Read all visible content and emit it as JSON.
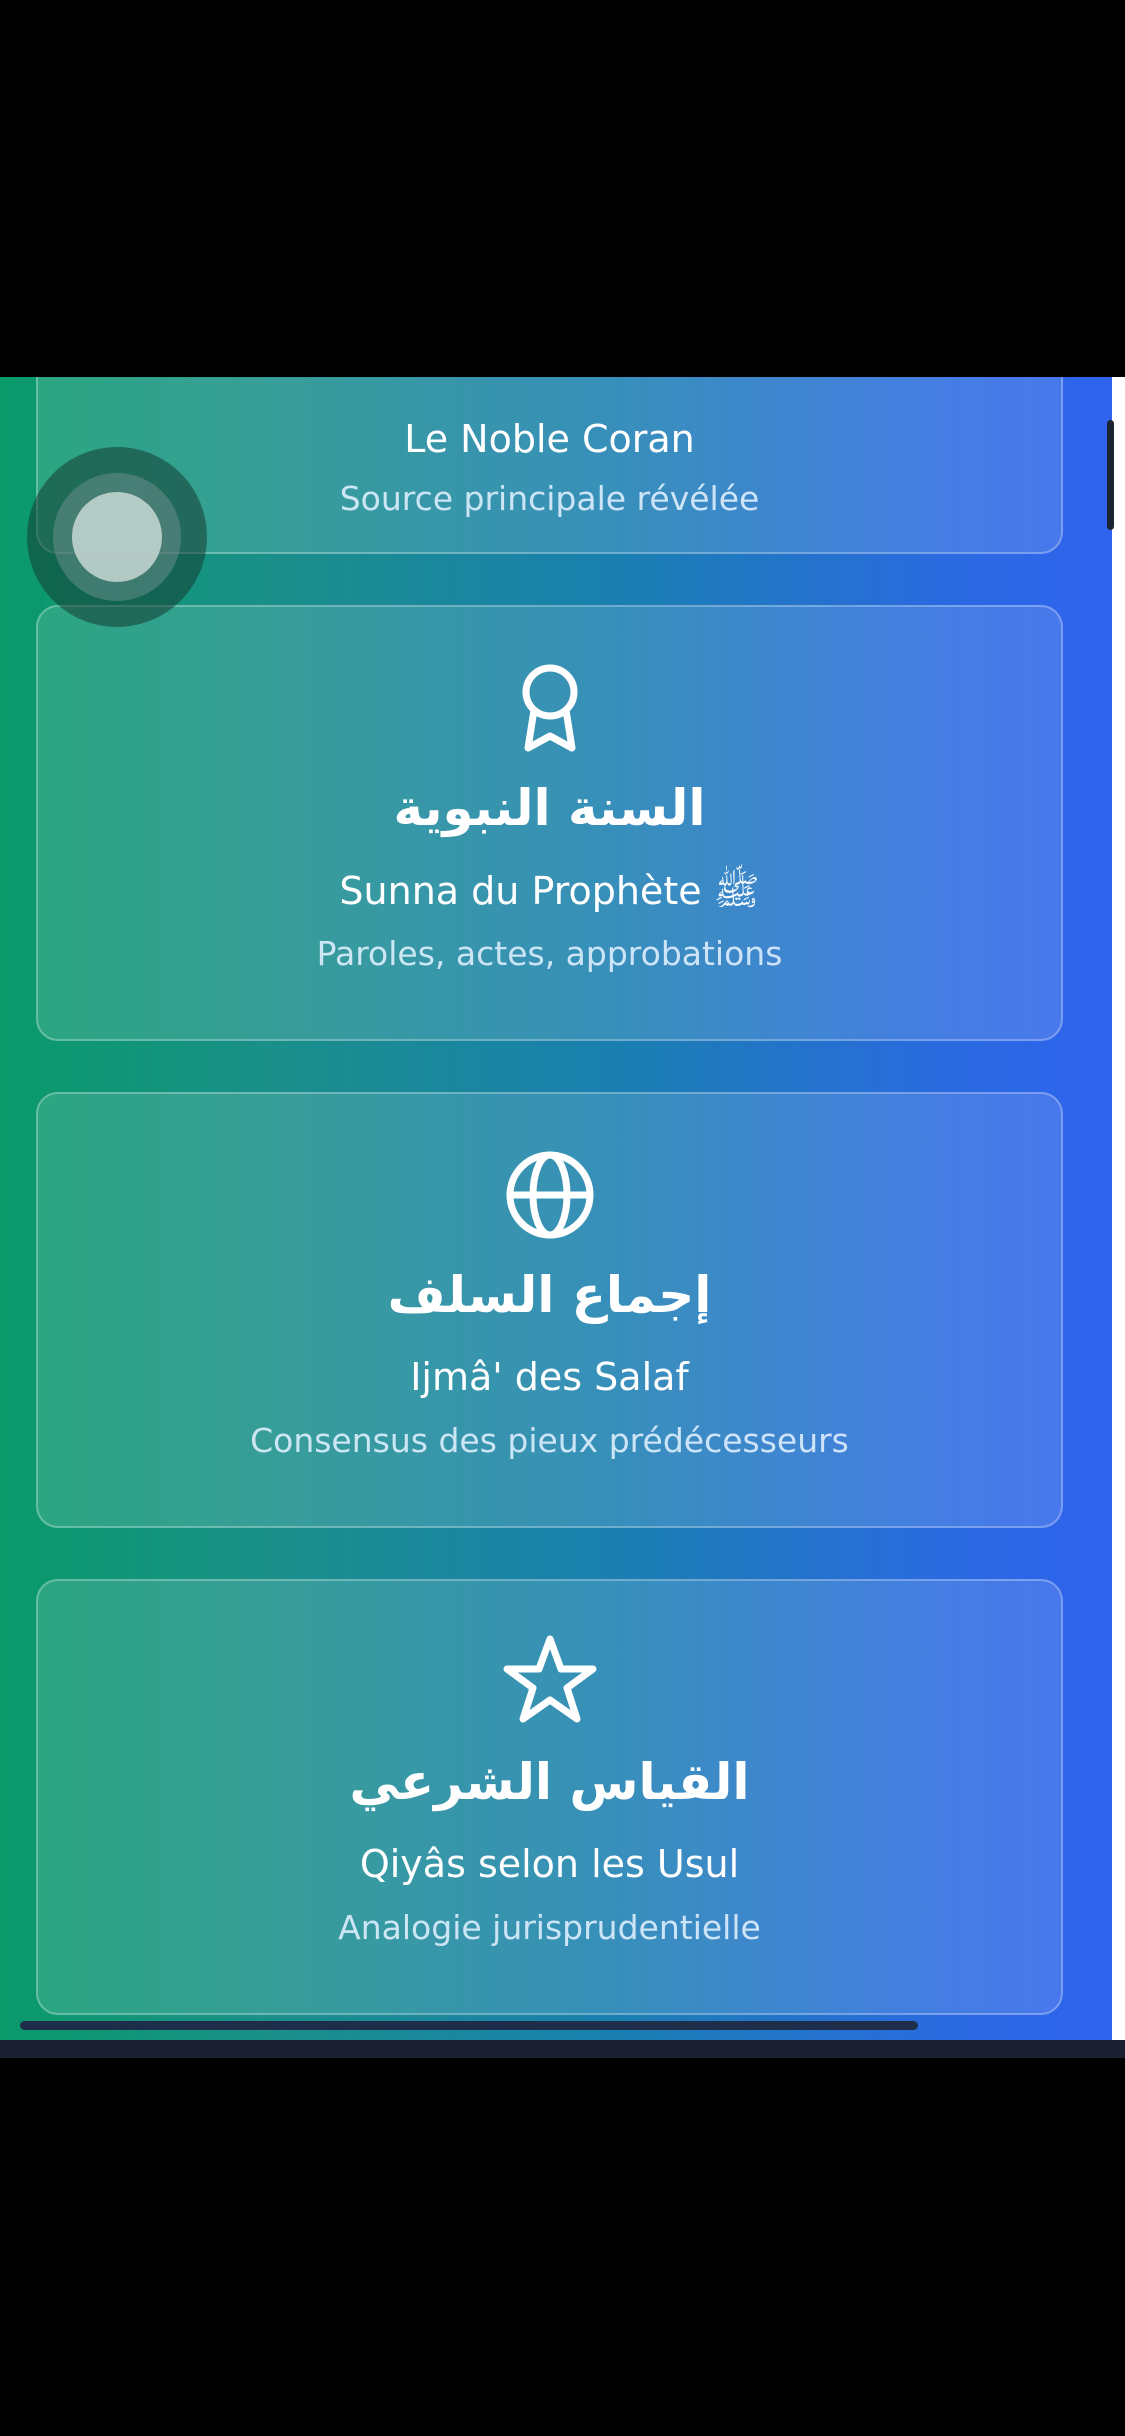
{
  "cards": [
    {
      "title": "Le Noble Coran",
      "subtitle": "Source principale révélée"
    },
    {
      "icon": "award-ribbon-icon",
      "arabic": "السنة النبوية",
      "title": "Sunna du Prophète ﷺ",
      "subtitle": "Paroles, actes, approbations"
    },
    {
      "icon": "globe-icon",
      "arabic": "إجماع السلف",
      "title": "Ijmâ' des Salaf",
      "subtitle": "Consensus des pieux prédécesseurs"
    },
    {
      "icon": "star-icon",
      "arabic": "القياس الشرعي",
      "title": "Qiyâs selon les Usul",
      "subtitle": "Analogie jurisprudentielle"
    }
  ],
  "colors": {
    "gradient_start": "#0a9a6a",
    "gradient_end": "#2f63ee",
    "text": "#ffffff"
  }
}
